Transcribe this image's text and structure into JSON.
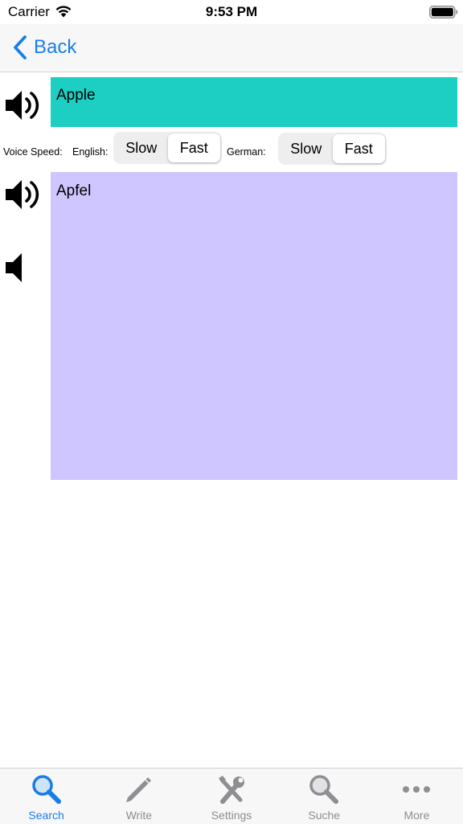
{
  "status_bar": {
    "carrier": "Carrier",
    "time": "9:53 PM",
    "wifi_icon": "wifi-icon",
    "battery_icon": "battery-icon"
  },
  "nav": {
    "back_label": "Back",
    "back_icon": "chevron-left-icon",
    "accent_color": "#1a7ee8"
  },
  "english": {
    "text": "Apple",
    "box_color": "#1ccfc2",
    "speaker_icon": "speaker-loud-icon"
  },
  "speed": {
    "voice_speed_label": "Voice Speed:",
    "english_label": "English:",
    "german_label": "German:",
    "english_options": [
      "Slow",
      "Fast"
    ],
    "english_selected": "Fast",
    "german_options": [
      "Slow",
      "Fast"
    ],
    "german_selected": "Fast"
  },
  "german": {
    "text": "Apfel",
    "box_color": "#cfc5ff",
    "speaker_icon": "speaker-loud-icon",
    "mute_icon": "speaker-mute-icon"
  },
  "tabs": [
    {
      "label": "Search",
      "icon": "magnifier-icon",
      "active": true
    },
    {
      "label": "Write",
      "icon": "pencil-icon",
      "active": false
    },
    {
      "label": "Settings",
      "icon": "tools-icon",
      "active": false
    },
    {
      "label": "Suche",
      "icon": "magnifier-icon",
      "active": false
    },
    {
      "label": "More",
      "icon": "ellipsis-icon",
      "active": false
    }
  ]
}
